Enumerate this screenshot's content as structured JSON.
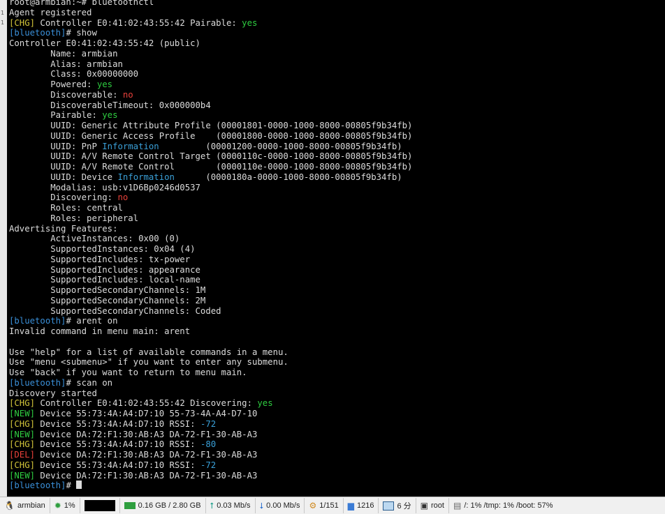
{
  "left_gutter_marks": [
    "1",
    "1"
  ],
  "terminal": {
    "lines": [
      [
        {
          "t": "root@armbian:~# bluetoothctl"
        }
      ],
      [
        {
          "t": "Agent registered"
        }
      ],
      [
        {
          "t": "[",
          "c": "c-tag-yellow"
        },
        {
          "t": "CHG",
          "c": "c-tag-yellow"
        },
        {
          "t": "]",
          "c": "c-tag-yellow"
        },
        {
          "t": " Controller E0:41:02:43:55:42 Pairable: "
        },
        {
          "t": "yes",
          "c": "c-yes"
        }
      ],
      [
        {
          "t": "[bluetooth]",
          "c": "c-tag-blue"
        },
        {
          "t": "# show"
        }
      ],
      [
        {
          "t": "Controller E0:41:02:43:55:42 (public)"
        }
      ],
      [
        {
          "t": "        Name: armbian"
        }
      ],
      [
        {
          "t": "        Alias: armbian"
        }
      ],
      [
        {
          "t": "        Class: 0x00000000"
        }
      ],
      [
        {
          "t": "        Powered: "
        },
        {
          "t": "yes",
          "c": "c-yes"
        }
      ],
      [
        {
          "t": "        Discoverable: "
        },
        {
          "t": "no",
          "c": "c-no"
        }
      ],
      [
        {
          "t": "        DiscoverableTimeout: 0x000000b4"
        }
      ],
      [
        {
          "t": "        Pairable: "
        },
        {
          "t": "yes",
          "c": "c-yes"
        }
      ],
      [
        {
          "t": "        UUID: Generic Attribute Profile (00001801-0000-1000-8000-00805f9b34fb)"
        }
      ],
      [
        {
          "t": "        UUID: Generic Access Profile    (00001800-0000-1000-8000-00805f9b34fb)"
        }
      ],
      [
        {
          "t": "        UUID: PnP "
        },
        {
          "t": "Information",
          "c": "c-info"
        },
        {
          "t": "         (00001200-0000-1000-8000-00805f9b34fb)"
        }
      ],
      [
        {
          "t": "        UUID: A/V Remote Control Target (0000110c-0000-1000-8000-00805f9b34fb)"
        }
      ],
      [
        {
          "t": "        UUID: A/V Remote Control        (0000110e-0000-1000-8000-00805f9b34fb)"
        }
      ],
      [
        {
          "t": "        UUID: Device "
        },
        {
          "t": "Information",
          "c": "c-info"
        },
        {
          "t": "      (0000180a-0000-1000-8000-00805f9b34fb)"
        }
      ],
      [
        {
          "t": "        Modalias: usb:v1D6Bp0246d0537"
        }
      ],
      [
        {
          "t": "        Discovering: "
        },
        {
          "t": "no",
          "c": "c-no"
        }
      ],
      [
        {
          "t": "        Roles: central"
        }
      ],
      [
        {
          "t": "        Roles: peripheral"
        }
      ],
      [
        {
          "t": "Advertising Features:"
        }
      ],
      [
        {
          "t": "        ActiveInstances: 0x00 (0)"
        }
      ],
      [
        {
          "t": "        SupportedInstances: 0x04 (4)"
        }
      ],
      [
        {
          "t": "        SupportedIncludes: tx-power"
        }
      ],
      [
        {
          "t": "        SupportedIncludes: appearance"
        }
      ],
      [
        {
          "t": "        SupportedIncludes: local-name"
        }
      ],
      [
        {
          "t": "        SupportedSecondaryChannels: 1M"
        }
      ],
      [
        {
          "t": "        SupportedSecondaryChannels: 2M"
        }
      ],
      [
        {
          "t": "        SupportedSecondaryChannels: Coded"
        }
      ],
      [
        {
          "t": "[bluetooth]",
          "c": "c-tag-blue"
        },
        {
          "t": "# arent on"
        }
      ],
      [
        {
          "t": "Invalid command in menu main: arent"
        }
      ],
      [
        {
          "t": ""
        }
      ],
      [
        {
          "t": "Use \"help\" for a list of available commands in a menu."
        }
      ],
      [
        {
          "t": "Use \"menu <submenu>\" if you want to enter any submenu."
        }
      ],
      [
        {
          "t": "Use \"back\" if you want to return to menu main."
        }
      ],
      [
        {
          "t": "[bluetooth]",
          "c": "c-tag-blue"
        },
        {
          "t": "# scan on"
        }
      ],
      [
        {
          "t": "Discovery started"
        }
      ],
      [
        {
          "t": "[",
          "c": "c-tag-yellow"
        },
        {
          "t": "CHG",
          "c": "c-tag-yellow"
        },
        {
          "t": "]",
          "c": "c-tag-yellow"
        },
        {
          "t": " Controller E0:41:02:43:55:42 Discovering: "
        },
        {
          "t": "yes",
          "c": "c-yes"
        }
      ],
      [
        {
          "t": "[",
          "c": "c-tag-green"
        },
        {
          "t": "NEW",
          "c": "c-tag-green"
        },
        {
          "t": "]",
          "c": "c-tag-green"
        },
        {
          "t": " Device 55:73:4A:A4:D7:10 55-73-4A-A4-D7-10"
        }
      ],
      [
        {
          "t": "[",
          "c": "c-tag-yellow"
        },
        {
          "t": "CHG",
          "c": "c-tag-yellow"
        },
        {
          "t": "]",
          "c": "c-tag-yellow"
        },
        {
          "t": " Device 55:73:4A:A4:D7:10 RSSI: "
        },
        {
          "t": "-72",
          "c": "c-info"
        }
      ],
      [
        {
          "t": "[",
          "c": "c-tag-green"
        },
        {
          "t": "NEW",
          "c": "c-tag-green"
        },
        {
          "t": "]",
          "c": "c-tag-green"
        },
        {
          "t": " Device DA:72:F1:30:AB:A3 DA-72-F1-30-AB-A3"
        }
      ],
      [
        {
          "t": "[",
          "c": "c-tag-yellow"
        },
        {
          "t": "CHG",
          "c": "c-tag-yellow"
        },
        {
          "t": "]",
          "c": "c-tag-yellow"
        },
        {
          "t": " Device 55:73:4A:A4:D7:10 RSSI: "
        },
        {
          "t": "-80",
          "c": "c-info"
        }
      ],
      [
        {
          "t": "[",
          "c": "c-tag-red"
        },
        {
          "t": "DEL",
          "c": "c-tag-red"
        },
        {
          "t": "]",
          "c": "c-tag-red"
        },
        {
          "t": " Device DA:72:F1:30:AB:A3 DA-72-F1-30-AB-A3"
        }
      ],
      [
        {
          "t": "[",
          "c": "c-tag-yellow"
        },
        {
          "t": "CHG",
          "c": "c-tag-yellow"
        },
        {
          "t": "]",
          "c": "c-tag-yellow"
        },
        {
          "t": " Device 55:73:4A:A4:D7:10 RSSI: "
        },
        {
          "t": "-72",
          "c": "c-info"
        }
      ],
      [
        {
          "t": "[",
          "c": "c-tag-green"
        },
        {
          "t": "NEW",
          "c": "c-tag-green"
        },
        {
          "t": "]",
          "c": "c-tag-green"
        },
        {
          "t": " Device DA:72:F1:30:AB:A3 DA-72-F1-30-AB-A3"
        }
      ],
      [
        {
          "t": "[bluetooth]",
          "c": "c-tag-blue"
        },
        {
          "t": "# "
        },
        {
          "cursor": true
        }
      ]
    ]
  },
  "status_bar": {
    "host": "armbian",
    "cpu": "1%",
    "memory": "0.16 GB / 2.80 GB",
    "upload": "0.03 Mb/s",
    "download": "0.00 Mb/s",
    "processes": "1/151",
    "files": "1216",
    "uptime": "6 分",
    "user": "root",
    "disks": "/: 1%   /tmp: 1%   /boot: 57%"
  }
}
